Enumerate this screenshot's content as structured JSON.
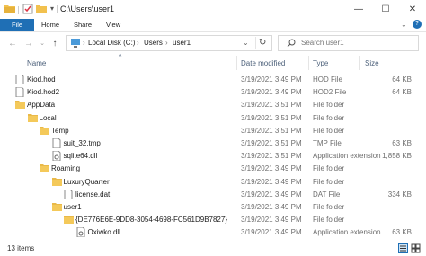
{
  "window": {
    "title": "C:\\Users\\user1",
    "minimize_icon": "—",
    "maximize_icon": "☐",
    "close_icon": "✕",
    "help_icon": "?"
  },
  "ribbon": {
    "tabs": [
      {
        "label": "File"
      },
      {
        "label": "Home"
      },
      {
        "label": "Share"
      },
      {
        "label": "View"
      }
    ]
  },
  "address": {
    "crumbs": [
      "Local Disk (C:)",
      "Users",
      "user1"
    ]
  },
  "search": {
    "placeholder": "Search user1"
  },
  "columns": {
    "name": "Name",
    "date": "Date modified",
    "type": "Type",
    "size": "Size"
  },
  "files": [
    {
      "name": "Kiod.hod",
      "date": "3/19/2021 3:49 PM",
      "type": "HOD File",
      "size": "64 KB",
      "kind": "file",
      "indent": 0
    },
    {
      "name": "Kiod.hod2",
      "date": "3/19/2021 3:49 PM",
      "type": "HOD2 File",
      "size": "64 KB",
      "kind": "file",
      "indent": 0
    },
    {
      "name": "AppData",
      "date": "3/19/2021 3:51 PM",
      "type": "File folder",
      "size": "",
      "kind": "folder",
      "indent": 0
    },
    {
      "name": "Local",
      "date": "3/19/2021 3:51 PM",
      "type": "File folder",
      "size": "",
      "kind": "folder",
      "indent": 1
    },
    {
      "name": "Temp",
      "date": "3/19/2021 3:51 PM",
      "type": "File folder",
      "size": "",
      "kind": "folder",
      "indent": 2
    },
    {
      "name": "suit_32.tmp",
      "date": "3/19/2021 3:51 PM",
      "type": "TMP File",
      "size": "63 KB",
      "kind": "file",
      "indent": 3
    },
    {
      "name": "sqlite64.dll",
      "date": "3/19/2021 3:51 PM",
      "type": "Application extension",
      "size": "1,858 KB",
      "kind": "dll",
      "indent": 3
    },
    {
      "name": "Roaming",
      "date": "3/19/2021 3:49 PM",
      "type": "File folder",
      "size": "",
      "kind": "folder",
      "indent": 2
    },
    {
      "name": "LuxuryQuarter",
      "date": "3/19/2021 3:49 PM",
      "type": "File folder",
      "size": "",
      "kind": "folder",
      "indent": 3
    },
    {
      "name": "license.dat",
      "date": "3/19/2021 3:49 PM",
      "type": "DAT File",
      "size": "334 KB",
      "kind": "file",
      "indent": 4
    },
    {
      "name": "user1",
      "date": "3/19/2021 3:49 PM",
      "type": "File folder",
      "size": "",
      "kind": "folder",
      "indent": 3
    },
    {
      "name": "{DE776E6E-9DD8-3054-4698-FC561D9B7827}",
      "date": "3/19/2021 3:49 PM",
      "type": "File folder",
      "size": "",
      "kind": "folder",
      "indent": 4
    },
    {
      "name": "Oxiwko.dll",
      "date": "3/19/2021 3:49 PM",
      "type": "Application extension",
      "size": "63 KB",
      "kind": "dll",
      "indent": 5
    }
  ],
  "status": {
    "items": "13 items"
  },
  "colors": {
    "accent": "#1f6fb5",
    "folder": "#f2c14e",
    "header_text": "#4c607a"
  }
}
